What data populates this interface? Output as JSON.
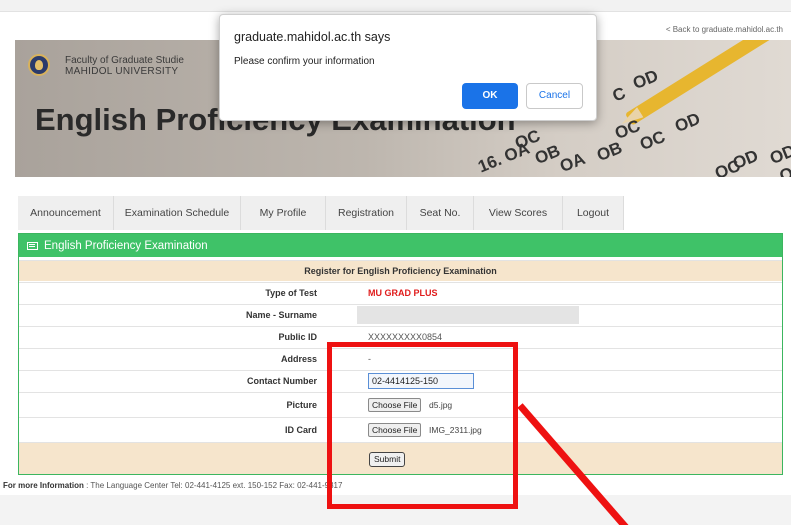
{
  "header": {
    "back_link": "< Back to graduate.mahidol.ac.th",
    "faculty_line1": "Faculty of Graduate Studie",
    "faculty_line2": "MAHIDOL UNIVERSITY",
    "banner_title": "English Proficiency Examination",
    "sheet_labels": [
      "C",
      "OD",
      "16. OA",
      "OC",
      "OD",
      "OA",
      "OB",
      "OC",
      "OD",
      "OC",
      "OD",
      "OB",
      "OC",
      "O"
    ]
  },
  "nav": {
    "tabs": [
      {
        "label": "Announcement"
      },
      {
        "label": "Examination Schedule"
      },
      {
        "label": "My Profile"
      },
      {
        "label": "Registration"
      },
      {
        "label": "Seat No."
      },
      {
        "label": "View Scores"
      },
      {
        "label": "Logout"
      }
    ]
  },
  "panel": {
    "heading": "English Proficiency Examination",
    "form_title": "Register for English Proficiency Examination",
    "type_of_test_label": "Type of Test",
    "type_of_test_value": "MU GRAD PLUS",
    "name_label": "Name - Surname",
    "public_id_label": "Public ID",
    "public_id_value": "XXXXXXXXX0854",
    "address_label": "Address",
    "address_value": "-",
    "contact_label": "Contact Number",
    "contact_value": "02-4414125-150",
    "picture_label": "Picture",
    "picture_button": "Choose File",
    "picture_file": "d5.jpg",
    "id_card_label": "ID Card",
    "id_card_button": "Choose File",
    "id_card_file": "IMG_2311.jpg",
    "submit_label": "Submit"
  },
  "footer": {
    "label": "For more Information",
    "text": " : The Language Center Tel: 02-441-4125 ext. 150-152 Fax: 02-441-9317"
  },
  "dialog": {
    "title": "graduate.mahidol.ac.th says",
    "message": "Please confirm your information",
    "ok_label": "OK",
    "cancel_label": "Cancel"
  },
  "colors": {
    "accent_green": "#3fc268",
    "beige": "#f6e5cc",
    "red_annotation": "#ee1111",
    "dialog_blue": "#1a73e8"
  }
}
